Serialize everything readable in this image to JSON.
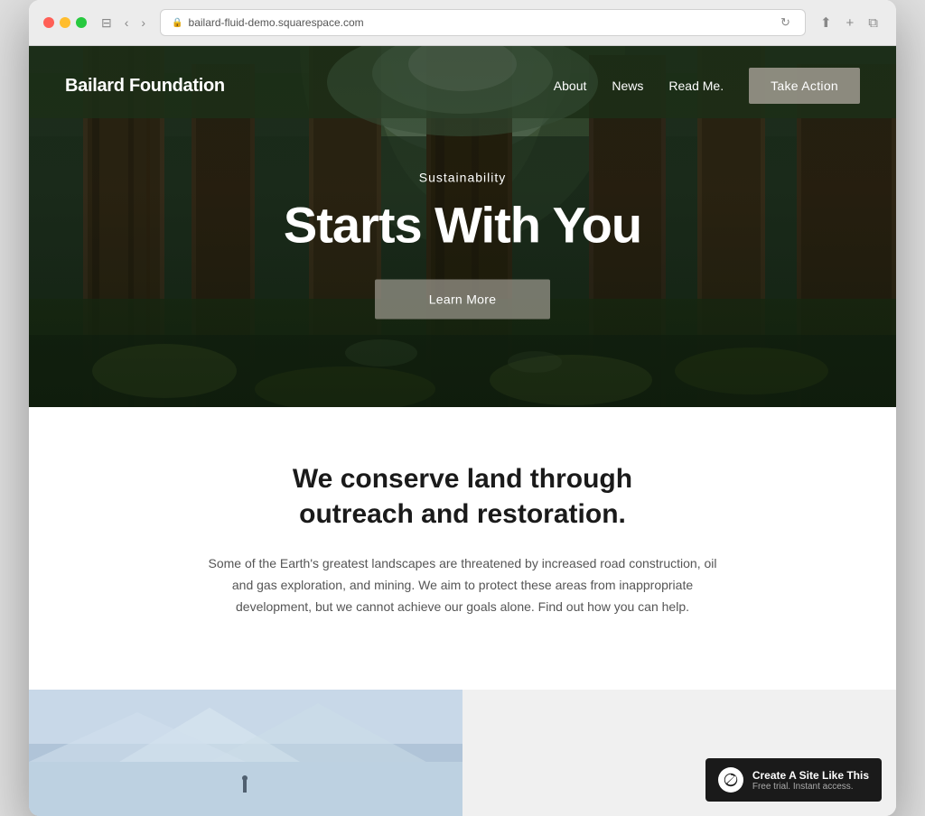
{
  "browser": {
    "url": "bailard-fluid-demo.squarespace.com",
    "back_btn": "‹",
    "forward_btn": "›",
    "refresh_icon": "↻",
    "share_icon": "⬆",
    "add_tab_icon": "+",
    "duplicate_icon": "⧉",
    "sidebar_icon": "⊟"
  },
  "nav": {
    "logo": "Bailard Foundation",
    "links": [
      "About",
      "News",
      "Read Me."
    ],
    "cta": "Take Action"
  },
  "hero": {
    "subtitle": "Sustainability",
    "title": "Starts With You",
    "button": "Learn More"
  },
  "content": {
    "heading": "We conserve land through outreach and restoration.",
    "body": "Some of the Earth's greatest landscapes are threatened by increased road construction, oil and gas exploration, and mining. We aim to protect these areas from inappropriate development, but we cannot achieve our goals alone. Find out how you can help."
  },
  "squarespace_badge": {
    "logo_text": "S",
    "title": "Create A Site Like This",
    "subtitle": "Free trial. Instant access."
  }
}
